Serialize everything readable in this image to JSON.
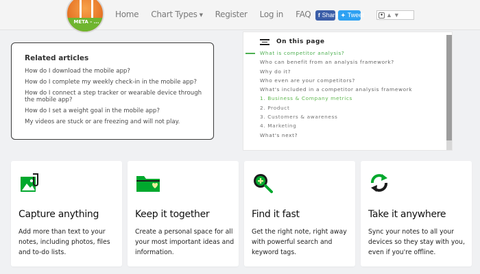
{
  "nav": {
    "logo_text": "META - ...",
    "items": [
      {
        "label": "Home"
      },
      {
        "label": "Chart Types",
        "has_caret": true
      },
      {
        "label": "Register"
      },
      {
        "label": "Log in"
      },
      {
        "label": "FAQ"
      }
    ],
    "share_label": "Share",
    "tweet_label": "Tweet",
    "colors": {
      "share": "#3b5ea8",
      "tweet": "#2ea1f2"
    }
  },
  "related": {
    "title": "Related articles",
    "links": [
      "How do I download the mobile app?",
      "How do I complete my weekly check-in in the mobile app?",
      "How do I connect a step tracker or wearable device through the mobile app?",
      "How do I set a weight goal in the mobile app?",
      "My videos are stuck or are freezing and will not play."
    ]
  },
  "toc": {
    "title": "On this page",
    "items": [
      {
        "label": "What is competitor analysis?",
        "state": "active"
      },
      {
        "label": "Who can benefit from an analysis framework?",
        "state": "normal"
      },
      {
        "label": "Why do it?",
        "state": "normal"
      },
      {
        "label": "Who even are your competitors?",
        "state": "normal"
      },
      {
        "label": "What's included in a competitor analysis framework",
        "state": "normal"
      },
      {
        "label": "1. Business & Company metrics",
        "state": "sub-green"
      },
      {
        "label": "2. Product",
        "state": "sub"
      },
      {
        "label": "3. Customers & awareness",
        "state": "sub"
      },
      {
        "label": "4. Marketing",
        "state": "sub"
      },
      {
        "label": "What's next?",
        "state": "normal"
      }
    ],
    "accent": "#4caf50"
  },
  "features": [
    {
      "icon": "photo-clip-icon",
      "title": "Capture anything",
      "text": "Add more than text to your notes, including photos, files and to-do lists."
    },
    {
      "icon": "folder-heart-icon",
      "title": "Keep it together",
      "text": "Create a personal space for all your most important ideas and information."
    },
    {
      "icon": "search-plus-icon",
      "title": "Find it fast",
      "text": "Get the right note, right away with powerful search and keyword tags."
    },
    {
      "icon": "sync-arrows-icon",
      "title": "Take it anywhere",
      "text": "Sync your notes to all your devices so they stay with you, even if you're offline."
    }
  ],
  "brand_color": "#00a82d"
}
